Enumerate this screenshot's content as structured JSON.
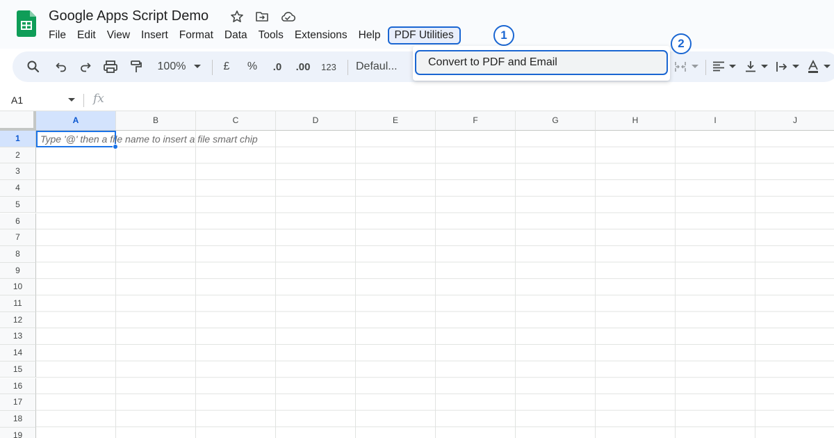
{
  "document": {
    "title": "Google Apps Script Demo"
  },
  "menubar": {
    "items": [
      {
        "label": "File"
      },
      {
        "label": "Edit"
      },
      {
        "label": "View"
      },
      {
        "label": "Insert"
      },
      {
        "label": "Format"
      },
      {
        "label": "Data"
      },
      {
        "label": "Tools"
      },
      {
        "label": "Extensions"
      },
      {
        "label": "Help"
      },
      {
        "label": "PDF Utilities"
      }
    ]
  },
  "callouts": {
    "step1": "1",
    "step2": "2"
  },
  "toolbar": {
    "zoom": "100%",
    "currency": "£",
    "percent": "%",
    "decrease_decimal": ".0",
    "increase_decimal": ".00",
    "number_format": "123",
    "font": "Defaul..."
  },
  "dropdown": {
    "item": "Convert to PDF and Email"
  },
  "formula_bar": {
    "cell_ref": "A1",
    "fx": "fx"
  },
  "grid": {
    "columns": [
      "A",
      "B",
      "C",
      "D",
      "E",
      "F",
      "G",
      "H",
      "I",
      "J"
    ],
    "rows": [
      "1",
      "2",
      "3",
      "4",
      "5",
      "6",
      "7",
      "8",
      "9",
      "10",
      "11",
      "12",
      "13",
      "14",
      "15",
      "16",
      "17",
      "18",
      "19"
    ],
    "active_cell_hint": "Type '@' then a file name to insert a file smart chip"
  },
  "colors": {
    "accent": "#1a66d2",
    "sheets_green": "#0f9d58",
    "toolbar_bg": "#edf2fa",
    "selection_bg": "#d3e3fd"
  },
  "icons": [
    "sheets-logo-icon",
    "star-icon",
    "move-folder-icon",
    "cloud-saved-icon",
    "search-icon",
    "undo-icon",
    "redo-icon",
    "print-icon",
    "paint-format-icon",
    "chevron-down-icon",
    "merge-cells-icon",
    "align-left-icon",
    "vertical-align-icon",
    "text-wrap-icon",
    "text-color-icon"
  ]
}
